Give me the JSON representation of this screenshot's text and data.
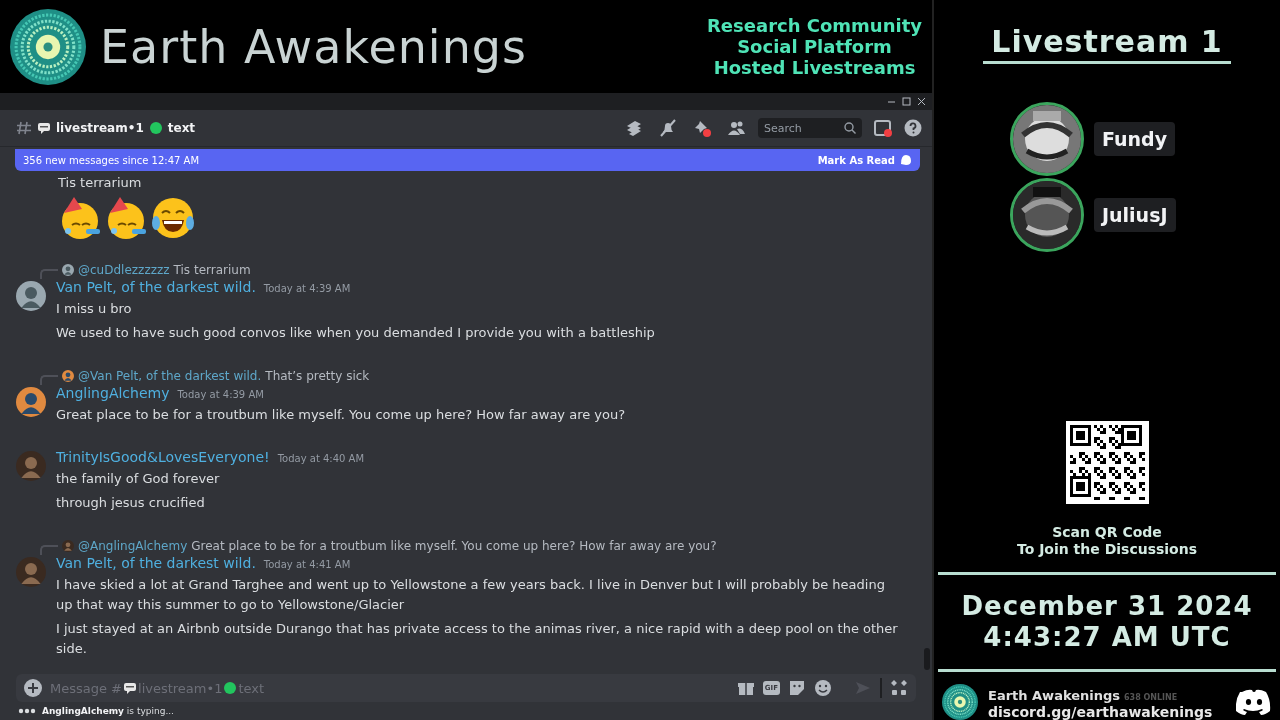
{
  "brand": {
    "title": "Earth Awakenings",
    "taglines": [
      "Research Community",
      "Social Platform",
      "Hosted Livestreams"
    ]
  },
  "window": {
    "controls": [
      {
        "kind": "minimize"
      },
      {
        "kind": "maximize"
      },
      {
        "kind": "close"
      }
    ]
  },
  "channel_header": {
    "name": "livestream•1",
    "suffix": "text",
    "search": {
      "placeholder": "Search"
    }
  },
  "banner": {
    "text": "356 new messages since 12:47 AM",
    "action": "Mark As Read"
  },
  "messages": [
    {
      "kind": "continuation",
      "lines": [
        "Tis terrarium"
      ],
      "emojis": [
        {
          "kind": "party"
        },
        {
          "kind": "party"
        },
        {
          "kind": "laugh"
        }
      ]
    },
    {
      "kind": "message",
      "reply": {
        "mention": "@cuDdlezzzzzz",
        "text": "Tis terrarium"
      },
      "author": "Van Pelt, of the darkest wild.",
      "time": "Today at 4:39 AM",
      "lines": [
        "I miss u bro",
        "We used to have such good convos like when you demanded I provide you with a battleship"
      ]
    },
    {
      "kind": "message",
      "reply": {
        "mention": "@Van Pelt, of the darkest wild.",
        "text": "That’s pretty sick"
      },
      "author": "AnglingAlchemy",
      "time": "Today at 4:39 AM",
      "lines": [
        "Great place to be for a troutbum like myself. You come up here? How far away are you?"
      ]
    },
    {
      "kind": "message",
      "author": "TrinityIsGood&LovesEveryone!",
      "time": "Today at 4:40 AM",
      "lines": [
        "the family of God forever",
        "through jesus crucified"
      ]
    },
    {
      "kind": "message",
      "reply": {
        "mention": "@AnglingAlchemy",
        "text": "Great place to be for a troutbum like myself. You come up here? How far away are you?"
      },
      "author": "Van Pelt, of the darkest wild.",
      "time": "Today at 4:41 AM",
      "lines": [
        "I have skied a lot at Grand Targhee and went up to Yellowstone a few years back. I live in Denver but I will probably be heading up that way this summer to go to Yellowstone/Glacier",
        "I just stayed at an Airbnb outside Durango that has private access to the animas river, a nice rapid with a deep pool on the other side."
      ]
    }
  ],
  "composer": {
    "prefix": "Message #",
    "channel": "livestream•1",
    "suffix": "text",
    "gif_label": "GIF"
  },
  "typing": "**AnglingAlchemy** is typing...",
  "stream": {
    "title": "Livestream 1",
    "speakers": [
      {
        "name": "Fundy",
        "speaking": true
      },
      {
        "name": "JuliusJ",
        "speaking": true
      }
    ],
    "qr_caption": [
      "Scan QR Code",
      "To Join the Discussions"
    ],
    "date": "December 31 2024",
    "time": "4:43:27 AM UTC",
    "server": {
      "name": "Earth Awakenings",
      "online": "638 ONLINE",
      "invite": "discord.gg/earthawakenings"
    }
  }
}
